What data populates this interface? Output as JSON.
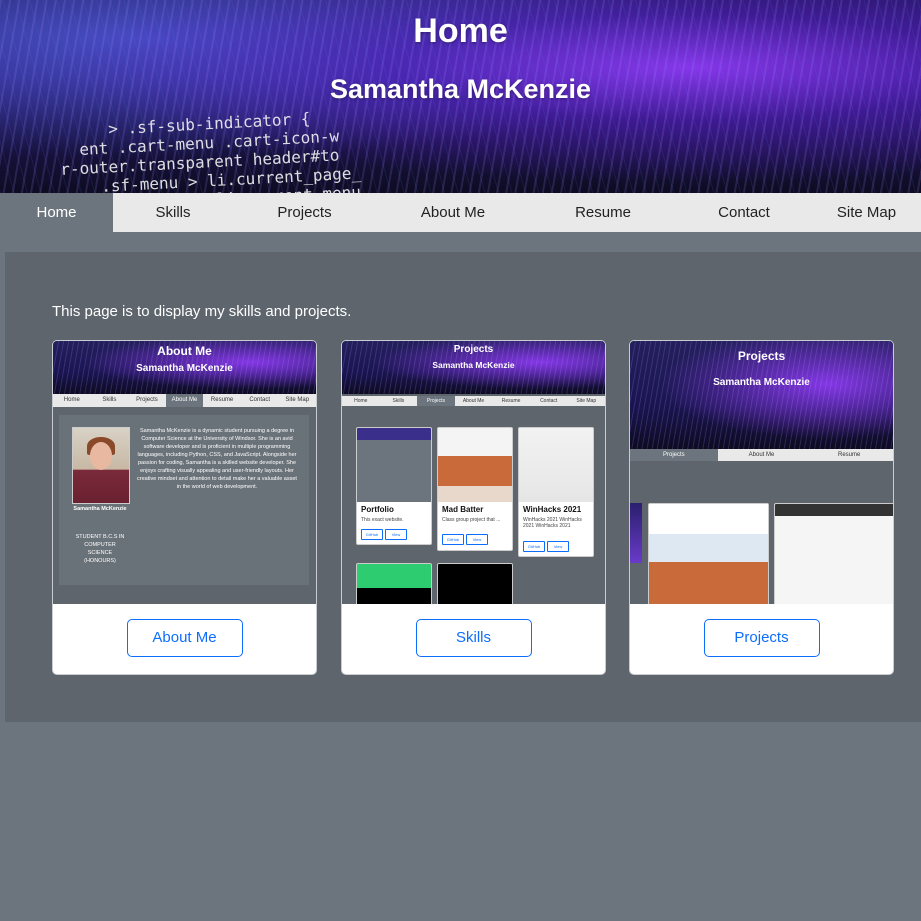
{
  "header": {
    "title": "Home",
    "subtitle": "Samantha McKenzie",
    "background_code": [
      "> .sf-sub-indicator {",
      "ent .cart-menu .cart-icon-w",
      "r-outer.transparent header#to",
      ".sf-menu > li.current_page_",
      "nav .sf-menu > li.current-menu"
    ]
  },
  "nav": {
    "items": [
      {
        "label": "Home",
        "active": true
      },
      {
        "label": "Skills"
      },
      {
        "label": "Projects"
      },
      {
        "label": "About Me"
      },
      {
        "label": "Resume"
      },
      {
        "label": "Contact"
      },
      {
        "label": "Site Map"
      }
    ]
  },
  "main": {
    "intro": "This page is to display my skills and projects.",
    "cards": [
      {
        "button": "About Me",
        "thumb": {
          "title": "About Me",
          "subtitle": "Samantha McKenzie",
          "nav": [
            "Home",
            "Skills",
            "Projects",
            "About Me",
            "Resume",
            "Contact",
            "Site Map"
          ],
          "name": "Samantha McKenzie",
          "role": "STUDENT B.C.S IN COMPUTER SCIENCE (HONOURS)",
          "bio": "Samantha McKenzie is a dynamic student pursuing a degree in Computer Science at the University of Windsor. She is an avid software developer and is proficient in multiple programming languages, including Python, CSS, and JavaScript. Alongside her passion for coding, Samantha is a skilled website developer. She enjoys crafting visually appealing and user-friendly layouts. Her creative mindset and attention to detail make her a valuable asset in the world of web development."
        }
      },
      {
        "button": "Skills",
        "thumb": {
          "title": "Projects",
          "subtitle": "Samantha McKenzie",
          "nav": [
            "Home",
            "Skills",
            "Projects",
            "About Me",
            "Resume",
            "Contact",
            "Site Map"
          ],
          "projects": [
            {
              "name": "Portfolio",
              "desc": "This exact website.",
              "btn1": "GitHub",
              "btn2": "View"
            },
            {
              "name": "Mad Batter",
              "desc": "Class group project that ...",
              "btn1": "GitHub",
              "btn2": "View"
            },
            {
              "name": "WinHacks 2021",
              "desc": "WinHacks 2021 WinHacks 2021 WinHacks 2021",
              "btn1": "GitHub",
              "btn2": "View"
            }
          ]
        }
      },
      {
        "button": "Projects",
        "thumb": {
          "title": "Projects",
          "subtitle": "Samantha McKenzie",
          "nav": [
            "Projects",
            "About Me",
            "Resume"
          ]
        }
      }
    ]
  },
  "colors": {
    "page_bg": "#6c757d",
    "panel_bg": "#5e656d",
    "nav_bg": "#e9e9ea",
    "accent": "#0d6efd"
  }
}
